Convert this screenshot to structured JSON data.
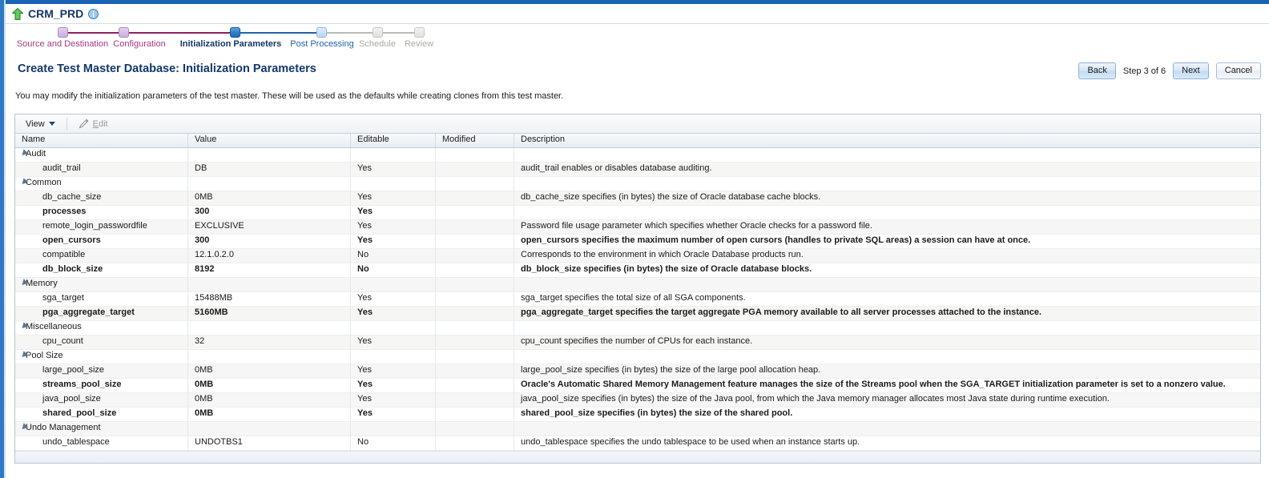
{
  "header": {
    "app_title": "CRM_PRD",
    "up_arrow_icon": "up-arrow-icon",
    "info_icon": "info-icon"
  },
  "train": {
    "steps": [
      {
        "label": "Source and Destination",
        "state": "done"
      },
      {
        "label": "Configuration",
        "state": "done"
      },
      {
        "label": "Initialization Parameters",
        "state": "current"
      },
      {
        "label": "Post Processing",
        "state": "next"
      },
      {
        "label": "Schedule",
        "state": "disabled"
      },
      {
        "label": "Review",
        "state": "disabled"
      }
    ]
  },
  "page": {
    "title": "Create Test Master Database: Initialization Parameters",
    "instructions": "You may modify the initialization parameters of the test master. These will be used as the defaults while creating clones from this test master.",
    "back_label": "Back",
    "step_text": "Step 3 of 6",
    "next_label": "Next",
    "cancel_label": "Cancel"
  },
  "toolbar": {
    "view_label": "View",
    "edit_label": "Edit",
    "edit_accesskey": "E",
    "edit_rest": "dit",
    "pencil_icon": "pencil-icon",
    "caret_icon": "chevron-down-icon"
  },
  "table": {
    "columns": [
      "Name",
      "Value",
      "Editable",
      "Modified",
      "Description"
    ],
    "rows": [
      {
        "type": "group",
        "name": "Audit",
        "value": "",
        "editable": "",
        "modified": "",
        "description": ""
      },
      {
        "type": "param",
        "name": "audit_trail",
        "value": "DB",
        "editable": "Yes",
        "modified": "",
        "description": "audit_trail enables or disables database auditing.",
        "bold": false
      },
      {
        "type": "group",
        "name": "Common",
        "value": "",
        "editable": "",
        "modified": "",
        "description": ""
      },
      {
        "type": "param",
        "name": "db_cache_size",
        "value": "0MB",
        "editable": "Yes",
        "modified": "",
        "description": "db_cache_size specifies (in bytes) the size of Oracle database cache blocks.",
        "bold": false
      },
      {
        "type": "param",
        "name": "processes",
        "value": "300",
        "editable": "Yes",
        "modified": "",
        "description": "",
        "bold": true
      },
      {
        "type": "param",
        "name": "remote_login_passwordfile",
        "value": "EXCLUSIVE",
        "editable": "Yes",
        "modified": "",
        "description": "Password file usage parameter which specifies whether Oracle checks for a password file.",
        "bold": false
      },
      {
        "type": "param",
        "name": "open_cursors",
        "value": "300",
        "editable": "Yes",
        "modified": "",
        "description": "open_cursors specifies the maximum number of open cursors (handles to private SQL areas) a session can have at once.",
        "bold": true
      },
      {
        "type": "param",
        "name": "compatible",
        "value": "12.1.0.2.0",
        "editable": "No",
        "modified": "",
        "description": "Corresponds to the environment in which Oracle Database products run.",
        "bold": false
      },
      {
        "type": "param",
        "name": "db_block_size",
        "value": "8192",
        "editable": "No",
        "modified": "",
        "description": "db_block_size specifies (in bytes) the size of Oracle database blocks.",
        "bold": true
      },
      {
        "type": "group",
        "name": "Memory",
        "value": "",
        "editable": "",
        "modified": "",
        "description": ""
      },
      {
        "type": "param",
        "name": "sga_target",
        "value": "15488MB",
        "editable": "Yes",
        "modified": "",
        "description": "sga_target specifies the total size of all SGA components.",
        "bold": false
      },
      {
        "type": "param",
        "name": "pga_aggregate_target",
        "value": "5160MB",
        "editable": "Yes",
        "modified": "",
        "description": "pga_aggregate_target specifies the target aggregate PGA memory available to all server processes attached to the instance.",
        "bold": true
      },
      {
        "type": "group",
        "name": "Miscellaneous",
        "value": "",
        "editable": "",
        "modified": "",
        "description": ""
      },
      {
        "type": "param",
        "name": "cpu_count",
        "value": "32",
        "editable": "Yes",
        "modified": "",
        "description": "cpu_count specifies the number of CPUs for each instance.",
        "bold": false
      },
      {
        "type": "group",
        "name": "Pool Size",
        "value": "",
        "editable": "",
        "modified": "",
        "description": ""
      },
      {
        "type": "param",
        "name": "large_pool_size",
        "value": "0MB",
        "editable": "Yes",
        "modified": "",
        "description": "large_pool_size specifies (in bytes) the size of the large pool allocation heap.",
        "bold": false
      },
      {
        "type": "param",
        "name": "streams_pool_size",
        "value": "0MB",
        "editable": "Yes",
        "modified": "",
        "description": "Oracle's Automatic Shared Memory Management feature manages the size of the Streams pool when the SGA_TARGET initialization parameter is set to a nonzero value.",
        "bold": true
      },
      {
        "type": "param",
        "name": "java_pool_size",
        "value": "0MB",
        "editable": "Yes",
        "modified": "",
        "description": "java_pool_size specifies (in bytes) the size of the Java pool, from which the Java memory manager allocates most Java state during runtime execution.",
        "bold": false
      },
      {
        "type": "param",
        "name": "shared_pool_size",
        "value": "0MB",
        "editable": "Yes",
        "modified": "",
        "description": "shared_pool_size specifies (in bytes) the size of the shared pool.",
        "bold": true
      },
      {
        "type": "group",
        "name": "Undo Management",
        "value": "",
        "editable": "",
        "modified": "",
        "description": ""
      },
      {
        "type": "param",
        "name": "undo_tablespace",
        "value": "UNDOTBS1",
        "editable": "No",
        "modified": "",
        "description": "undo_tablespace specifies the undo tablespace to be used when an instance starts up.",
        "bold": false
      }
    ]
  },
  "colors": {
    "accent_blue": "#13386b",
    "train_done": "#a33a80",
    "train_current": "#1e6fb4",
    "chrome_blue": "#1863b5"
  }
}
